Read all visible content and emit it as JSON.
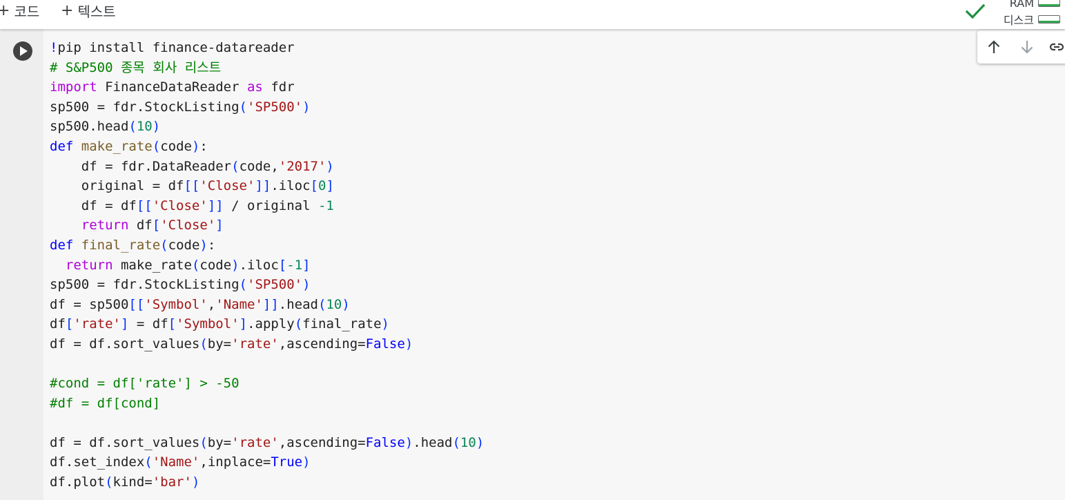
{
  "toolbar": {
    "add_code_label": "코드",
    "add_text_label": "텍스트",
    "plus_glyph": "+",
    "connected_icon": "check-icon",
    "resources": {
      "ram_label": "RAM",
      "disk_label": "디스크"
    },
    "colors": {
      "check": "#1e8e3e",
      "usage_fill": "#34a853"
    }
  },
  "cell": {
    "run_icon": "play-icon",
    "toolbar_icons": [
      "arrow-up-icon",
      "arrow-down-icon",
      "link-icon"
    ],
    "code_lines": [
      [
        {
          "t": "sh",
          "v": "!"
        },
        {
          "t": "",
          "v": "pip install finance-datareader"
        }
      ],
      [
        {
          "t": "cmt",
          "v": "# S&P500 종목 회사 리스트"
        }
      ],
      [
        {
          "t": "kw",
          "v": "import"
        },
        {
          "t": "",
          "v": " FinanceDataReader "
        },
        {
          "t": "kw",
          "v": "as"
        },
        {
          "t": "",
          "v": " fdr"
        }
      ],
      [
        {
          "t": "",
          "v": "sp500 = fdr.StockListing"
        },
        {
          "t": "bl",
          "v": "("
        },
        {
          "t": "str",
          "v": "'SP500'"
        },
        {
          "t": "bl",
          "v": ")"
        }
      ],
      [
        {
          "t": "",
          "v": "sp500.head"
        },
        {
          "t": "bl",
          "v": "("
        },
        {
          "t": "num",
          "v": "10"
        },
        {
          "t": "bl",
          "v": ")"
        }
      ],
      [
        {
          "t": "df",
          "v": "def"
        },
        {
          "t": "",
          "v": " "
        },
        {
          "t": "fn",
          "v": "make_rate"
        },
        {
          "t": "bl",
          "v": "("
        },
        {
          "t": "",
          "v": "code"
        },
        {
          "t": "bl",
          "v": ")"
        },
        {
          "t": "",
          "v": ":"
        }
      ],
      [
        {
          "t": "",
          "v": "    df = fdr.DataReader"
        },
        {
          "t": "bl",
          "v": "("
        },
        {
          "t": "",
          "v": "code,"
        },
        {
          "t": "str",
          "v": "'2017'"
        },
        {
          "t": "bl",
          "v": ")"
        }
      ],
      [
        {
          "t": "",
          "v": "    original = df"
        },
        {
          "t": "bl",
          "v": "[["
        },
        {
          "t": "str",
          "v": "'Close'"
        },
        {
          "t": "bl",
          "v": "]]"
        },
        {
          "t": "",
          "v": ".iloc"
        },
        {
          "t": "bl",
          "v": "["
        },
        {
          "t": "num",
          "v": "0"
        },
        {
          "t": "bl",
          "v": "]"
        }
      ],
      [
        {
          "t": "",
          "v": "    df = df"
        },
        {
          "t": "bl",
          "v": "[["
        },
        {
          "t": "str",
          "v": "'Close'"
        },
        {
          "t": "bl",
          "v": "]]"
        },
        {
          "t": "",
          "v": " / original "
        },
        {
          "t": "num",
          "v": "-1"
        }
      ],
      [
        {
          "t": "",
          "v": "    "
        },
        {
          "t": "kw",
          "v": "return"
        },
        {
          "t": "",
          "v": " df"
        },
        {
          "t": "bl",
          "v": "["
        },
        {
          "t": "str",
          "v": "'Close'"
        },
        {
          "t": "bl",
          "v": "]"
        }
      ],
      [
        {
          "t": "df",
          "v": "def"
        },
        {
          "t": "",
          "v": " "
        },
        {
          "t": "fn",
          "v": "final_rate"
        },
        {
          "t": "bl",
          "v": "("
        },
        {
          "t": "",
          "v": "code"
        },
        {
          "t": "bl",
          "v": ")"
        },
        {
          "t": "",
          "v": ":"
        }
      ],
      [
        {
          "t": "",
          "v": "  "
        },
        {
          "t": "kw",
          "v": "return"
        },
        {
          "t": "",
          "v": " make_rate"
        },
        {
          "t": "bl",
          "v": "("
        },
        {
          "t": "",
          "v": "code"
        },
        {
          "t": "bl",
          "v": ")"
        },
        {
          "t": "",
          "v": ".iloc"
        },
        {
          "t": "bl",
          "v": "["
        },
        {
          "t": "num",
          "v": "-1"
        },
        {
          "t": "bl",
          "v": "]"
        }
      ],
      [
        {
          "t": "",
          "v": "sp500 = fdr.StockListing"
        },
        {
          "t": "bl",
          "v": "("
        },
        {
          "t": "str",
          "v": "'SP500'"
        },
        {
          "t": "bl",
          "v": ")"
        }
      ],
      [
        {
          "t": "",
          "v": "df = sp500"
        },
        {
          "t": "bl",
          "v": "[["
        },
        {
          "t": "str",
          "v": "'Symbol'"
        },
        {
          "t": "",
          "v": ","
        },
        {
          "t": "str",
          "v": "'Name'"
        },
        {
          "t": "bl",
          "v": "]]"
        },
        {
          "t": "",
          "v": ".head"
        },
        {
          "t": "bl",
          "v": "("
        },
        {
          "t": "num",
          "v": "10"
        },
        {
          "t": "bl",
          "v": ")"
        }
      ],
      [
        {
          "t": "",
          "v": "df"
        },
        {
          "t": "bl",
          "v": "["
        },
        {
          "t": "str",
          "v": "'rate'"
        },
        {
          "t": "bl",
          "v": "]"
        },
        {
          "t": "",
          "v": " = df"
        },
        {
          "t": "bl",
          "v": "["
        },
        {
          "t": "str",
          "v": "'Symbol'"
        },
        {
          "t": "bl",
          "v": "]"
        },
        {
          "t": "",
          "v": ".apply"
        },
        {
          "t": "bl",
          "v": "("
        },
        {
          "t": "",
          "v": "final_rate"
        },
        {
          "t": "bl",
          "v": ")"
        }
      ],
      [
        {
          "t": "",
          "v": "df = df.sort_values"
        },
        {
          "t": "bl",
          "v": "("
        },
        {
          "t": "",
          "v": "by="
        },
        {
          "t": "str",
          "v": "'rate'"
        },
        {
          "t": "",
          "v": ",ascending="
        },
        {
          "t": "bool",
          "v": "False"
        },
        {
          "t": "bl",
          "v": ")"
        }
      ],
      [
        {
          "t": "",
          "v": ""
        }
      ],
      [
        {
          "t": "cmt",
          "v": "#cond = df['rate'] > -50"
        }
      ],
      [
        {
          "t": "cmt",
          "v": "#df = df[cond]"
        }
      ],
      [
        {
          "t": "",
          "v": ""
        }
      ],
      [
        {
          "t": "",
          "v": "df = df.sort_values"
        },
        {
          "t": "bl",
          "v": "("
        },
        {
          "t": "",
          "v": "by="
        },
        {
          "t": "str",
          "v": "'rate'"
        },
        {
          "t": "",
          "v": ",ascending="
        },
        {
          "t": "bool",
          "v": "False"
        },
        {
          "t": "bl",
          "v": ")"
        },
        {
          "t": "",
          "v": ".head"
        },
        {
          "t": "bl",
          "v": "("
        },
        {
          "t": "num",
          "v": "10"
        },
        {
          "t": "bl",
          "v": ")"
        }
      ],
      [
        {
          "t": "",
          "v": "df.set_index"
        },
        {
          "t": "bl",
          "v": "("
        },
        {
          "t": "str",
          "v": "'Name'"
        },
        {
          "t": "",
          "v": ",inplace="
        },
        {
          "t": "bool",
          "v": "True"
        },
        {
          "t": "bl",
          "v": ")"
        }
      ],
      [
        {
          "t": "",
          "v": "df.plot"
        },
        {
          "t": "bl",
          "v": "("
        },
        {
          "t": "",
          "v": "kind="
        },
        {
          "t": "str",
          "v": "'bar'"
        },
        {
          "t": "bl",
          "v": ")"
        }
      ]
    ]
  }
}
